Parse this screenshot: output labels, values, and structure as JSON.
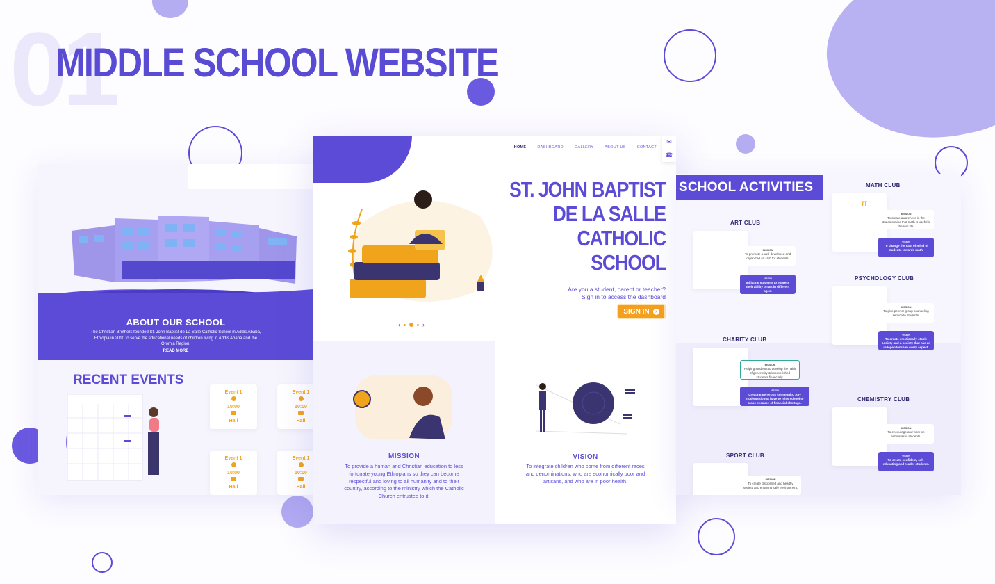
{
  "header": {
    "number": "01",
    "title": "MIDDLE SCHOOL WEBSITE"
  },
  "about": {
    "heading": "ABOUT OUR SCHOOL",
    "text": "The Christian Brothers founded St. John Baptist de La Salle Catholic School in Addis Ababa, Ethiopia in 2010 to serve the educational needs of children living in Addis Ababa and the Oromia Region.",
    "read_more": "READ MORE"
  },
  "events": {
    "heading": "RECENT EVENTS",
    "cards": [
      {
        "title": "Event 1",
        "time": "10:00",
        "place": "Hall"
      },
      {
        "title": "Event 1",
        "time": "10:00",
        "place": "Hall"
      },
      {
        "title": "Event 1",
        "time": "10:00",
        "place": "Hall"
      },
      {
        "title": "Event 1",
        "time": "10:00",
        "place": "Hall"
      }
    ]
  },
  "nav": {
    "items": [
      "HOME",
      "DASHBOARD",
      "GALLERY",
      "ABOUT US",
      "CONTACT"
    ],
    "active": "HOME"
  },
  "hero": {
    "title_line1": "ST. JOHN BAPTIST",
    "title_line2": "DE LA SALLE CATHOLIC",
    "title_line3": "SCHOOL",
    "prompt_line1": "Are you a student, parent or teacher?",
    "prompt_line2": "Sign in to access the dashboard",
    "signin_label": "SIGN IN",
    "carousel_prev": "‹",
    "carousel_next": "›"
  },
  "mission": {
    "heading": "MISSION",
    "text": "To provide a human and Christian education to less fortunate young Ethiopians so they can become respectful and loving to all humanity and to their country, according to the ministry which the Catholic Church entrusted to it."
  },
  "vision": {
    "heading": "VISION",
    "text": "To integrate children who come from different races and denominations, who are economically poor and artisans, and who are in poor health."
  },
  "activities": {
    "heading": "SCHOOL ACTIVITIES",
    "clubs": [
      {
        "name": "ART CLUB",
        "mission_label": "MISSION",
        "mission": "To promote a well-developed and organized art club for students.",
        "vision_label": "VISION",
        "vision": "Initiating students to express their ability on art in different ages."
      },
      {
        "name": "MATH CLUB",
        "mission_label": "MISSION",
        "mission": "To create awareness in the students mind that math is useful in the real life.",
        "vision_label": "VISION",
        "vision": "To change the cast of mind of students towards math."
      },
      {
        "name": "PSYCHOLOGY CLUB",
        "mission_label": "MISSION",
        "mission": "To give peer or group counseling service to students.",
        "vision_label": "VISION",
        "vision": "To create emotionally stable society and a society that has an independence in every aspect."
      },
      {
        "name": "CHARITY CLUB",
        "mission_label": "MISSION",
        "mission": "Helping students to develop the habit of generosity & impoverished students financially.",
        "vision_label": "VISION",
        "vision": "Creating generous community. Any students do not have to miss school or class because of financial shortage."
      },
      {
        "name": "CHEMISTRY CLUB",
        "mission_label": "MISSION",
        "mission": "To encourage and work on enthusiastic students.",
        "vision_label": "VISION",
        "vision": "To create confident, self-educating and reader students."
      },
      {
        "name": "SPORT CLUB",
        "mission_label": "MISSION",
        "mission": "To create disciplined and healthy society and ensuring safe environment."
      }
    ]
  },
  "colors": {
    "brand": "#5b4bd6",
    "accent": "#f5a01d",
    "soft": "#b4adf2"
  },
  "icons": [
    "mail-icon",
    "phone-icon",
    "clock-icon",
    "building-icon",
    "arrow-right-icon"
  ]
}
